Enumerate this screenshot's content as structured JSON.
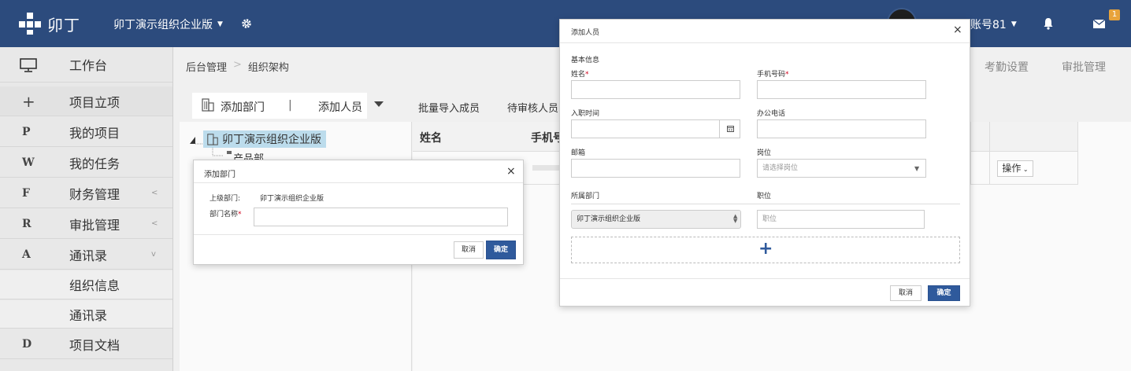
{
  "header": {
    "logo_text": "卯丁",
    "org_name": "卯丁演示组织企业版",
    "account_name": "账号81",
    "mail_count": "1"
  },
  "sidebar": {
    "items": [
      {
        "icon": "monitor-icon",
        "glyph": "",
        "label": "工作台"
      },
      {
        "icon": "plus-icon",
        "glyph": "+",
        "label": "项目立项"
      },
      {
        "icon": "letter-p-icon",
        "glyph": "P",
        "label": "我的项目"
      },
      {
        "icon": "letter-w-icon",
        "glyph": "W",
        "label": "我的任务"
      },
      {
        "icon": "letter-f-icon",
        "glyph": "F",
        "label": "财务管理",
        "caret": "<"
      },
      {
        "icon": "letter-r-icon",
        "glyph": "R",
        "label": "审批管理",
        "caret": "<"
      },
      {
        "icon": "letter-a-icon",
        "glyph": "A",
        "label": "通讯录",
        "caret": "v"
      },
      {
        "icon": "",
        "glyph": "",
        "label": "组织信息"
      },
      {
        "icon": "",
        "glyph": "",
        "label": "通讯录"
      },
      {
        "icon": "letter-d-icon",
        "glyph": "D",
        "label": "项目文档"
      }
    ]
  },
  "breadcrumb": {
    "root": "后台管理",
    "sep": ">",
    "current": "组织架构"
  },
  "top_tabs": [
    "考勤设置",
    "审批管理"
  ],
  "toolbar": {
    "add_dept": "添加部门",
    "divider": "|",
    "add_person": "添加人员",
    "batch_import": "批量导入成员",
    "pending_review": "待审核人员"
  },
  "tree": {
    "root": "卯丁演示组织企业版",
    "child": "产品部"
  },
  "table": {
    "headers": [
      "姓名",
      "手机号"
    ],
    "row_action": "操作"
  },
  "dialog_add_dept": {
    "title": "添加部门",
    "close": "×",
    "parent_label": "上级部门:",
    "parent_value": "卯丁演示组织企业版",
    "name_label": "部门名称",
    "required_mark": "*",
    "cancel": "取消",
    "ok": "确定"
  },
  "dialog_add_person": {
    "title": "添加人员",
    "close": "×",
    "section": "基本信息",
    "name_label": "姓名",
    "phone_label": "手机号码",
    "required_mark": "*",
    "join_date_label": "入职时间",
    "office_phone_label": "办公电话",
    "email_label": "邮箱",
    "post_label": "岗位",
    "post_placeholder": "请选择岗位",
    "dept_label": "所属部门",
    "title_label": "职位",
    "dept_value": "卯丁演示组织企业版",
    "title_placeholder": "职位",
    "add_row": "+",
    "cancel": "取消",
    "ok": "确定"
  },
  "colors": {
    "topbar": "#2c4b7d",
    "primary_button": "#2f5a9c",
    "tree_highlight": "#bcdcec",
    "required": "#d0021b",
    "badge": "#e8a33b"
  }
}
